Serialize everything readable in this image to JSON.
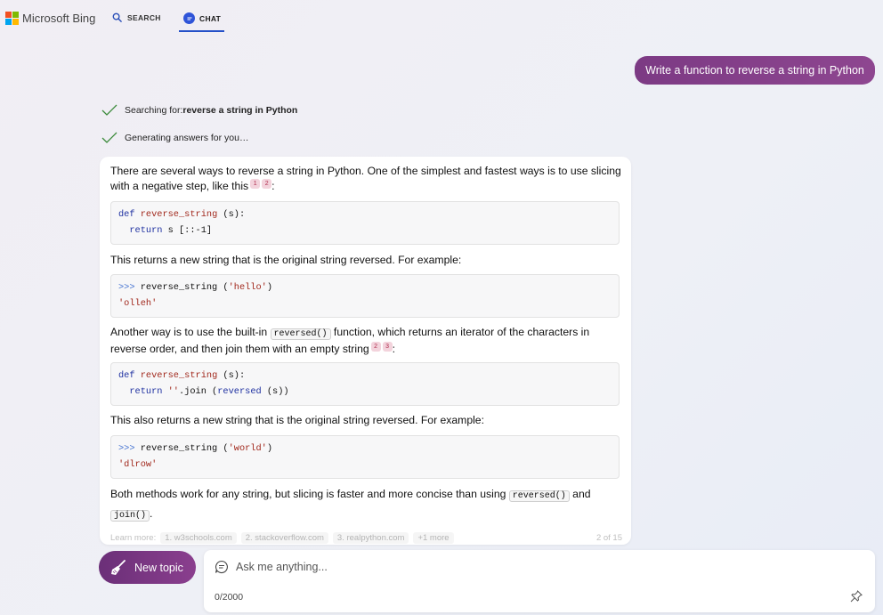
{
  "header": {
    "brand": "Microsoft Bing",
    "brand_colors": [
      "#f25022",
      "#7fba00",
      "#00a4ef",
      "#ffb900"
    ],
    "tabs": [
      {
        "label": "SEARCH",
        "icon": "search-icon",
        "active": false
      },
      {
        "label": "CHAT",
        "icon": "chat-icon",
        "active": true
      }
    ],
    "accent": "#2450c8"
  },
  "user_message": "Write a function to reverse a string in Python",
  "status": {
    "searching_prefix": "Searching for: ",
    "searching_query": "reverse a string in Python",
    "generating": "Generating answers for you…"
  },
  "answer": {
    "p1": "There are several ways to reverse a string in Python. One of the simplest and fastest ways is to use slicing with a negative step, like this",
    "p1_cites": [
      "1",
      "2"
    ],
    "p1_end": ":",
    "code1": {
      "kw1": "def",
      "fn": "reverse_string",
      "args": " (s):",
      "kw2": "return",
      "body": " s [::-1]"
    },
    "p2": "This returns a new string that is the original string reversed. For example:",
    "code2": {
      "prompt": ">>>",
      "call": " reverse_string (",
      "arg": "'hello'",
      "close": ")",
      "result": "'olleh'"
    },
    "p3_a": "Another way is to use the built-in ",
    "p3_code": "reversed()",
    "p3_b": " function, which returns an iterator of the characters in reverse order, and then join them with an empty string",
    "p3_cites": [
      "2",
      "3"
    ],
    "p3_end": ":",
    "code3": {
      "kw1": "def",
      "fn": "reverse_string",
      "args": " (s):",
      "kw2": "return",
      "str": " ''",
      "mid": ".join (",
      "fn2": "reversed",
      "tail": " (s))"
    },
    "p4": "This also returns a new string that is the original string reversed. For example:",
    "code4": {
      "prompt": ">>>",
      "call": " reverse_string (",
      "arg": "'world'",
      "close": ")",
      "result": "'dlrow'"
    },
    "p5_a": "Both methods work for any string, but slicing is faster and more concise than using ",
    "p5_code1": "reversed()",
    "p5_b": " and ",
    "p5_code2": "join()",
    "p5_end": ".",
    "learn_more": {
      "label": "Learn more:",
      "links": [
        "1. w3schools.com",
        "2. stackoverflow.com",
        "3. realpython.com",
        "+1 more"
      ],
      "count": "2 of 15"
    }
  },
  "footer": {
    "new_topic": "New topic",
    "input_placeholder": "Ask me anything...",
    "char_count": "0/2000"
  }
}
